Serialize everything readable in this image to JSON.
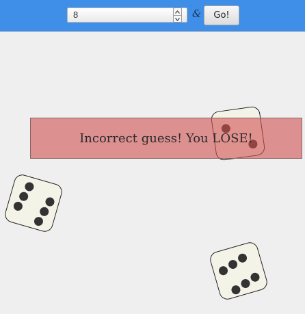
{
  "controls": {
    "guess_value": "8",
    "separator": "&",
    "go_label": "Go!"
  },
  "result": {
    "message": "Incorrect guess! You LOSE!",
    "outcome_color": "#d05050"
  },
  "dice": [
    {
      "value": 2
    },
    {
      "value": 6
    },
    {
      "value": 6
    }
  ]
}
